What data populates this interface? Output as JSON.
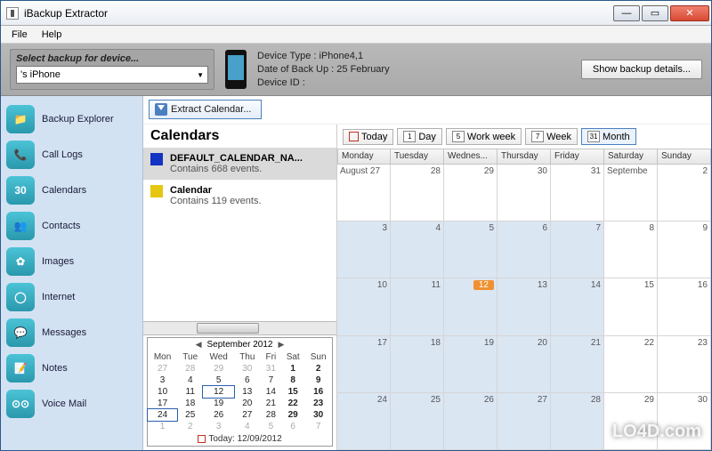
{
  "window": {
    "title": "iBackup Extractor"
  },
  "menu": {
    "file": "File",
    "help": "Help"
  },
  "device": {
    "select_label": "Select backup for device...",
    "selected": "'s iPhone",
    "type_label": "Device Type :",
    "type_value": "iPhone4,1",
    "date_label": "Date of Back Up :",
    "date_value": "25 February",
    "id_label": "Device ID :",
    "details_btn": "Show backup details..."
  },
  "sidebar": {
    "items": [
      {
        "label": "Backup Explorer",
        "icon": "📁"
      },
      {
        "label": "Call Logs",
        "icon": "📞"
      },
      {
        "label": "Calendars",
        "icon": "30"
      },
      {
        "label": "Contacts",
        "icon": "👥"
      },
      {
        "label": "Images",
        "icon": "✿"
      },
      {
        "label": "Internet",
        "icon": "◯"
      },
      {
        "label": "Messages",
        "icon": "💬"
      },
      {
        "label": "Notes",
        "icon": "📝"
      },
      {
        "label": "Voice Mail",
        "icon": "⊙⊙"
      }
    ]
  },
  "extract_btn": "Extract Calendar...",
  "calendars": {
    "title": "Calendars",
    "items": [
      {
        "name": "DEFAULT_CALENDAR_NA...",
        "sub": "Contains 668 events.",
        "color": "#1333c2"
      },
      {
        "name": "Calendar",
        "sub": "Contains 119 events.",
        "color": "#e7c611"
      }
    ]
  },
  "minical": {
    "title": "September 2012",
    "dow": [
      "Mon",
      "Tue",
      "Wed",
      "Thu",
      "Fri",
      "Sat",
      "Sun"
    ],
    "today_label": "Today: 12/09/2012",
    "rows": [
      [
        {
          "d": "27",
          "o": true
        },
        {
          "d": "28",
          "o": true
        },
        {
          "d": "29",
          "o": true
        },
        {
          "d": "30",
          "o": true
        },
        {
          "d": "31",
          "o": true
        },
        {
          "d": "1",
          "b": true
        },
        {
          "d": "2",
          "b": true
        }
      ],
      [
        {
          "d": "3"
        },
        {
          "d": "4"
        },
        {
          "d": "5"
        },
        {
          "d": "6"
        },
        {
          "d": "7"
        },
        {
          "d": "8",
          "b": true
        },
        {
          "d": "9",
          "b": true
        }
      ],
      [
        {
          "d": "10"
        },
        {
          "d": "11"
        },
        {
          "d": "12",
          "box": true
        },
        {
          "d": "13"
        },
        {
          "d": "14"
        },
        {
          "d": "15",
          "b": true
        },
        {
          "d": "16",
          "b": true
        }
      ],
      [
        {
          "d": "17"
        },
        {
          "d": "18"
        },
        {
          "d": "19"
        },
        {
          "d": "20"
        },
        {
          "d": "21"
        },
        {
          "d": "22",
          "b": true
        },
        {
          "d": "23",
          "b": true
        }
      ],
      [
        {
          "d": "24",
          "box": true
        },
        {
          "d": "25"
        },
        {
          "d": "26"
        },
        {
          "d": "27"
        },
        {
          "d": "28"
        },
        {
          "d": "29",
          "b": true
        },
        {
          "d": "30",
          "b": true
        }
      ],
      [
        {
          "d": "1",
          "o": true
        },
        {
          "d": "2",
          "o": true
        },
        {
          "d": "3",
          "o": true
        },
        {
          "d": "4",
          "o": true
        },
        {
          "d": "5",
          "o": true
        },
        {
          "d": "6",
          "o": true
        },
        {
          "d": "7",
          "o": true
        }
      ]
    ]
  },
  "viewbar": {
    "today": "Today",
    "day": "Day",
    "workweek": "Work week",
    "week": "Week",
    "month": "Month",
    "n1": "1",
    "n5": "5",
    "n7": "7",
    "n31": "31"
  },
  "grid": {
    "headers": [
      "Monday",
      "Tuesday",
      "Wednes...",
      "Thursday",
      "Friday",
      "Saturday",
      "Sunday"
    ],
    "rows": [
      [
        {
          "tl": "August 27",
          "shade": false
        },
        {
          "dn": "28"
        },
        {
          "dn": "29"
        },
        {
          "dn": "30"
        },
        {
          "dn": "31"
        },
        {
          "tl": "Septembe"
        },
        {
          "dn": "2"
        }
      ],
      [
        {
          "dn": "3",
          "shade": true
        },
        {
          "dn": "4",
          "shade": true
        },
        {
          "dn": "5",
          "shade": true
        },
        {
          "dn": "6",
          "shade": true
        },
        {
          "dn": "7",
          "shade": true
        },
        {
          "dn": "8"
        },
        {
          "dn": "9"
        }
      ],
      [
        {
          "dn": "10",
          "shade": true
        },
        {
          "dn": "11",
          "shade": true
        },
        {
          "dn": "12",
          "shade": true,
          "hl": true
        },
        {
          "dn": "13",
          "shade": true
        },
        {
          "dn": "14",
          "shade": true
        },
        {
          "dn": "15"
        },
        {
          "dn": "16"
        }
      ],
      [
        {
          "dn": "17",
          "shade": true
        },
        {
          "dn": "18",
          "shade": true
        },
        {
          "dn": "19",
          "shade": true
        },
        {
          "dn": "20",
          "shade": true
        },
        {
          "dn": "21",
          "shade": true
        },
        {
          "dn": "22"
        },
        {
          "dn": "23"
        }
      ],
      [
        {
          "dn": "24",
          "shade": true
        },
        {
          "dn": "25",
          "shade": true
        },
        {
          "dn": "26",
          "shade": true
        },
        {
          "dn": "27",
          "shade": true
        },
        {
          "dn": "28",
          "shade": true
        },
        {
          "dn": "29"
        },
        {
          "dn": "30"
        }
      ]
    ]
  },
  "watermark": "LO4D.com"
}
